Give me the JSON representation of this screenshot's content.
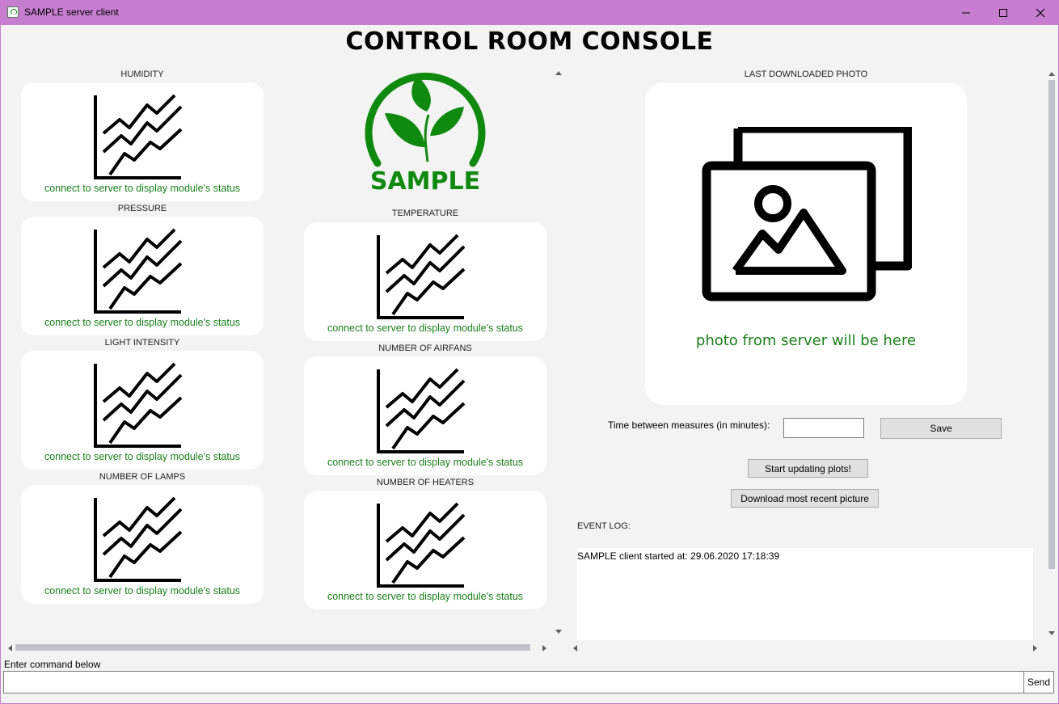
{
  "window": {
    "title": "SAMPLE server client",
    "frame_color": "#c77dd0"
  },
  "header": {
    "title": "CONTROL ROOM CONSOLE"
  },
  "logo": {
    "text": "SAMPLE",
    "color": "#0f8a0f",
    "icon": "leaf-logo-icon"
  },
  "modules": [
    {
      "label": "HUMIDITY",
      "status": "connect to server to display module's status"
    },
    {
      "label": "PRESSURE",
      "status": "connect to server to display module's status"
    },
    {
      "label": "LIGHT INTENSITY",
      "status": "connect to server to display module's status"
    },
    {
      "label": "NUMBER OF LAMPS",
      "status": "connect to server to display module's status"
    },
    {
      "label": "TEMPERATURE",
      "status": "connect to server to display module's status"
    },
    {
      "label": "NUMBER OF AIRFANS",
      "status": "connect to server to display module's status"
    },
    {
      "label": "NUMBER OF HEATERS",
      "status": "connect to server to display module's status"
    }
  ],
  "photo": {
    "label": "LAST DOWNLOADED PHOTO",
    "placeholder": "photo from server will be here",
    "icon": "photo-gallery-icon"
  },
  "controls": {
    "measure_label": "Time between measures (in minutes):",
    "measure_value": "",
    "save_label": "Save",
    "start_label": "Start updating plots!",
    "download_label": "Download most recent picture"
  },
  "event_log": {
    "label": "EVENT LOG:",
    "lines": [
      "SAMPLE client started at: 29.06.2020 17:18:39"
    ]
  },
  "command": {
    "label": "Enter command below",
    "value": "",
    "send_label": "Send"
  },
  "colors": {
    "status_text": "#1a7f1a",
    "background": "#f3f3f3"
  }
}
